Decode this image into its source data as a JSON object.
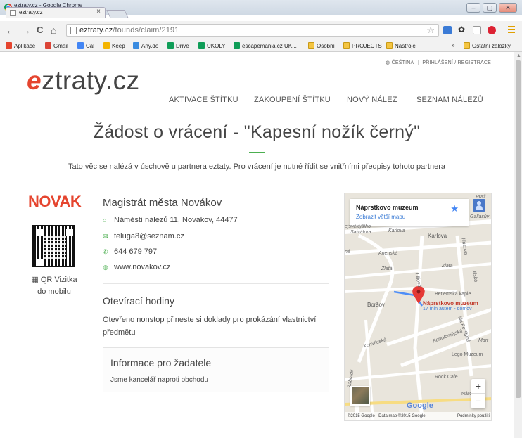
{
  "window": {
    "title": "eztraty.cz - Google Chrome",
    "tab_title": "eztraty.cz",
    "tab_close": "×"
  },
  "toolbar": {
    "back": "←",
    "forward": "→",
    "reload": "C",
    "home": "⌂",
    "url_host": "eztraty.cz",
    "url_path": "/founds/claim/2191"
  },
  "bookmarks": [
    {
      "label": "Aplikace",
      "icon": "apps-icon",
      "color": "#e5452f"
    },
    {
      "label": "Gmail",
      "icon": "gmail-icon",
      "color": "#db4437"
    },
    {
      "label": "Cal",
      "icon": "calendar-icon",
      "color": "#4285f4"
    },
    {
      "label": "Keep",
      "icon": "keep-icon",
      "color": "#f4b400"
    },
    {
      "label": "Any.do",
      "icon": "anydo-icon",
      "color": "#3a8be0"
    },
    {
      "label": "Drive",
      "icon": "drive-icon",
      "color": "#0f9d58"
    },
    {
      "label": "UKOLY",
      "icon": "sheets-icon",
      "color": "#0f9d58"
    },
    {
      "label": "escapemania.cz UK...",
      "icon": "sheets-icon",
      "color": "#0f9d58"
    },
    {
      "label": "Osobní",
      "icon": "folder-icon",
      "color": "#f4c542"
    },
    {
      "label": "PROJECTS",
      "icon": "folder-icon",
      "color": "#f4c542"
    },
    {
      "label": "Nástroje",
      "icon": "folder-icon",
      "color": "#f4c542"
    },
    {
      "label": "»",
      "icon": "",
      "color": ""
    },
    {
      "label": "Ostatní záložky",
      "icon": "folder-icon",
      "color": "#f4c542"
    }
  ],
  "site": {
    "logo_e": "e",
    "logo_rest": "ztraty.cz",
    "lang": "ČEŠTINA",
    "login": "PŘIHLÁŠENÍ / REGISTRACE",
    "nav": [
      "AKTIVACE ŠTÍTKU",
      "ZAKOUPENÍ ŠTÍTKU",
      "NOVÝ NÁLEZ",
      "SEZNAM NÁLEZŮ"
    ]
  },
  "main": {
    "title": "Žádost o vrácení - \"Kapesní nožík černý\"",
    "subtitle": "Tato věc se nalézá v úschově u partnera eztaty. Pro vrácení je nutné řídit se vnitřními předpisy tohoto partnera"
  },
  "partner": {
    "logo_text": "NOVAK",
    "qr_label_line1": "QR Vizitka",
    "qr_label_line2": "do mobilu",
    "name": "Magistrát města Novákov",
    "address": "Náměstí nálezů 11, Novákov, 44477",
    "email": "teluga8@seznam.cz",
    "phone": "644 679 797",
    "web": "www.novakov.cz",
    "hours_title": "Otevírací hodiny",
    "hours_text": "Otevřeno nonstop přineste si doklady pro prokázání vlastnictví předmětu",
    "info_title": "Informace pro žadatele",
    "info_text": "Jsme kancelář naproti obchodu"
  },
  "map": {
    "place": "Náprstkovo muzeum",
    "larger_map": "Zobrazit větší mapu",
    "marker_label": "Náprstkovo muzeum",
    "marker_sub": "17 min autem - domov",
    "labels": {
      "praz": "Praž",
      "gallas": "Gallasův",
      "betlem_top": "ejsvětějšího",
      "salvator": "Salvátora",
      "karlova1": "Karlova",
      "karlova2": "Karlova",
      "husova": "Husova",
      "anenska": "Anenská",
      "zlata1": "Zlatá",
      "zlata2": "Zlatá",
      "liliova": "Liliová",
      "jilska": "Jilská",
      "betlemska": "Betlémská kaple",
      "borsov": "Boršov",
      "naperstku": "Na Perštýně",
      "konviktska": "Konviktská",
      "bartolomejska": "Bartolomějská",
      "mart": "Mart",
      "lego": "Lego Muzeum",
      "rockcafe": "Rock Cafe",
      "naro": "Náro",
      "zadeln": "Zábradlí",
      "ne": "né"
    },
    "zoom_in": "+",
    "zoom_out": "−",
    "google": "Google",
    "footer": "©2015 Google - Data map ©2015 Google",
    "terms": "Podmínky použití"
  }
}
